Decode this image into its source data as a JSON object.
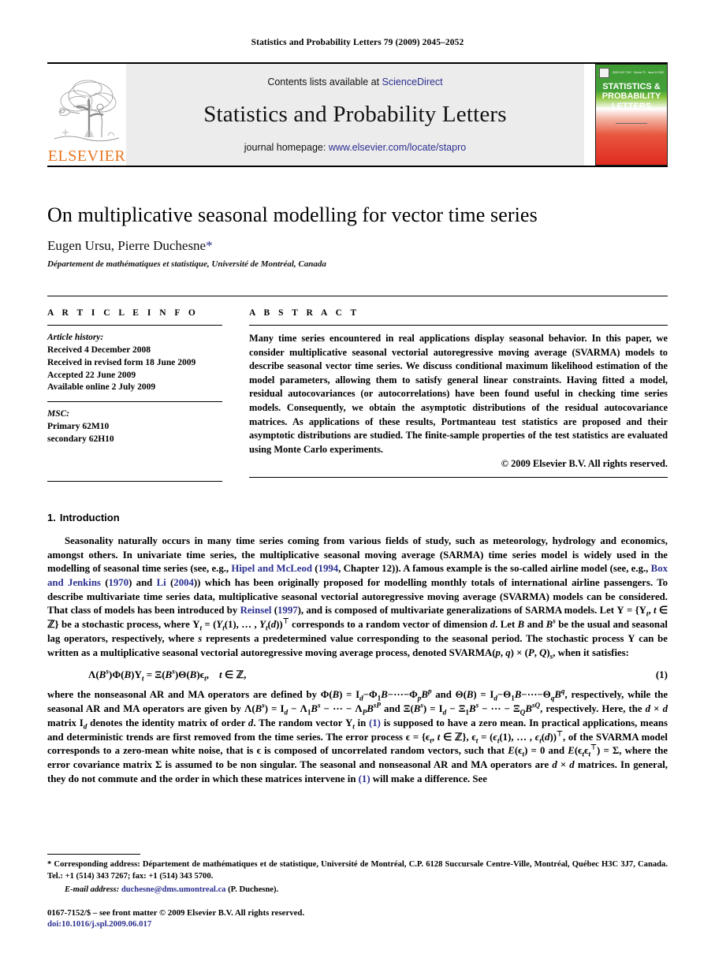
{
  "running_head": "Statistics and Probability Letters 79 (2009) 2045–2052",
  "masthead": {
    "publisher_wordmark": "ELSEVIER",
    "contents_prefix": "Contents lists available at ",
    "contents_link": "ScienceDirect",
    "journal_name": "Statistics and Probability Letters",
    "homepage_prefix": "journal homepage: ",
    "homepage_link": "www.elsevier.com/locate/stapro",
    "cover": {
      "title_line1": "STATISTICS &",
      "title_line2": "PROBABILITY",
      "title_line3": "LETTERS",
      "meta_left": "ISSN 0167-7152",
      "meta_mid": "Volume 79",
      "meta_right": "Issue 20 2009"
    }
  },
  "article": {
    "title": "On multiplicative seasonal modelling for vector time series",
    "authors": "Eugen Ursu, Pierre Duchesne",
    "corresponding_marker": "*",
    "affiliation": "Département de mathématiques et statistique, Université de Montréal, Canada"
  },
  "info": {
    "heading": "A R T I C L E    I N F O",
    "history_label": "Article history:",
    "history": [
      "Received 4 December 2008",
      "Received in revised form 18 June 2009",
      "Accepted 22 June 2009",
      "Available online 2 July 2009"
    ],
    "msc_label": "MSC:",
    "msc": [
      "Primary 62M10",
      "secondary 62H10"
    ]
  },
  "abstract": {
    "heading": "A B S T R A C T",
    "text": "Many time series encountered in real applications display seasonal behavior. In this paper, we consider multiplicative seasonal vectorial autoregressive moving average (SVARMA) models to describe seasonal vector time series. We discuss conditional maximum likelihood estimation of the model parameters, allowing them to satisfy general linear constraints. Having fitted a model, residual autocovariances (or autocorrelations) have been found useful in checking time series models. Consequently, we obtain the asymptotic distributions of the residual autocovariance matrices. As applications of these results, Portmanteau test statistics are proposed and their asymptotic distributions are studied. The finite-sample properties of the test statistics are evaluated using Monte Carlo experiments.",
    "copyright": "© 2009 Elsevier B.V. All rights reserved."
  },
  "introduction": {
    "number": "1.",
    "title": "Introduction",
    "para1_a": "Seasonality naturally occurs in many time series coming from various fields of study, such as meteorology, hydrology and economics, amongst others. In univariate time series, the multiplicative seasonal moving average (SARMA) time series model is widely used in the modelling of seasonal time series (see, e.g., ",
    "cite_hipel": "Hipel and McLeod",
    "para1_b": " (",
    "cite_hipel_year": "1994",
    "para1_c": ", Chapter 12)). A famous example is the so-called airline model (see, e.g., ",
    "cite_box": "Box and Jenkins",
    "para1_d": " (",
    "cite_box_year": "1970",
    "para1_e": ") and ",
    "cite_li": "Li",
    "para1_f": " (",
    "cite_li_year": "2004",
    "para1_g": ")) which has been originally proposed for modelling monthly totals of international airline passengers. To describe multivariate time series data, multiplicative seasonal vectorial autoregressive moving average (SVARMA) models can be considered. That class of models has been introduced by ",
    "cite_reinsel": "Reinsel",
    "para1_h": " (",
    "cite_reinsel_year": "1997",
    "para1_i": "), and is composed of multivariate generalizations of SARMA models. Let ",
    "para1_j": " be a stochastic process, where ",
    "para1_k": " corresponds to a random vector of dimension ",
    "para1_l": ". Let ",
    "para1_m": " and ",
    "para1_n": " be the usual and seasonal lag operators, respectively, where ",
    "para1_o": " represents a predetermined value corresponding to the seasonal period. The stochastic process ",
    "para1_p": " can be written as a multiplicative seasonal vectorial autoregressive moving average process, denoted SVARMA",
    "para1_q": ", when it satisfies:",
    "equation_number": "(1)",
    "para2_a": "where the nonseasonal AR and MA operators are defined by ",
    "para2_b": " and ",
    "para2_c": ", respectively, while the seasonal AR and MA operators are given by ",
    "para2_d": ", respectively. Here, the ",
    "para2_e": " matrix ",
    "para2_f": " denotes the identity matrix of order ",
    "para2_g": ". The random vector ",
    "para2_h": " in ",
    "eq_ref_1": "(1)",
    "para2_i": " is supposed to have a zero mean. In practical applications, means and deterministic trends are first removed from the time series. The error process ",
    "para2_j": ", of the SVARMA model corresponds to a zero-mean white noise, that is ",
    "para2_k": " is composed of uncorrelated random vectors, such that ",
    "para2_l": ", where the error covariance matrix ",
    "para2_m": " is assumed to be non singular. The seasonal and nonseasonal AR and MA operators are ",
    "para2_n": " matrices. In general, they do not commute and the order in which these matrices intervene in ",
    "eq_ref_2": "(1)",
    "para2_o": " will make a difference. See"
  },
  "footnotes": {
    "marker": "*",
    "corresponding": " Corresponding address: Département de mathématiques et de statistique, Université de Montréal, C.P. 6128 Succursale Centre-Ville, Montréal, Québec H3C 3J7, Canada. Tel.: +1 (514) 343 7267; fax: +1 (514) 343 5700.",
    "email_label": "E-mail address:",
    "email_link": "duchesne@dms.umontreal.ca",
    "email_suffix": " (P. Duchesne)."
  },
  "imprint": {
    "issn_line": "0167-7152/$ – see front matter © 2009 Elsevier B.V. All rights reserved.",
    "doi_line": "doi:10.1016/j.spl.2009.06.017"
  },
  "colors": {
    "link": "#2b2f8f",
    "elsevier_orange": "#e87722",
    "masthead_bg": "#ececec"
  }
}
